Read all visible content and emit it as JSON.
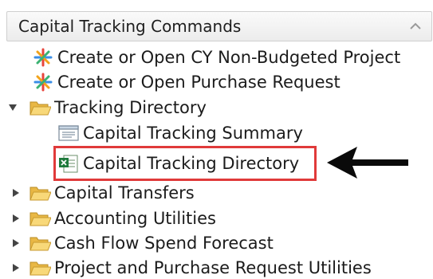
{
  "panel": {
    "title": "Capital Tracking Commands",
    "collapse_icon": "chevron-up-icon"
  },
  "tree": {
    "items": [
      {
        "label": "Create or Open CY Non-Budgeted Project",
        "icon": "asterisk-burst-icon"
      },
      {
        "label": "Create or Open Purchase Request",
        "icon": "asterisk-burst-icon"
      },
      {
        "label": "Tracking Directory",
        "icon": "folder-open-icon",
        "expanded": true
      },
      {
        "label": "Capital Tracking Summary",
        "icon": "report-window-icon"
      },
      {
        "label": "Capital Tracking Directory",
        "icon": "excel-file-icon",
        "highlighted": true
      },
      {
        "label": "Capital Transfers",
        "icon": "folder-open-icon",
        "expanded": false
      },
      {
        "label": "Accounting Utilities",
        "icon": "folder-open-icon",
        "expanded": false
      },
      {
        "label": "Cash Flow Spend Forecast",
        "icon": "folder-open-icon",
        "expanded": false
      },
      {
        "label": "Project and Purchase Request Utilities",
        "icon": "folder-open-icon",
        "expanded": false
      }
    ]
  },
  "annotation": {
    "icon": "left-arrow-icon",
    "highlight_color": "#e03a3a"
  },
  "colors": {
    "folder": "#f2c75c",
    "excel": "#1e7a3c",
    "burst_colors": [
      "#e8453c",
      "#3a8ee6",
      "#f2a31b",
      "#3bb273"
    ]
  }
}
